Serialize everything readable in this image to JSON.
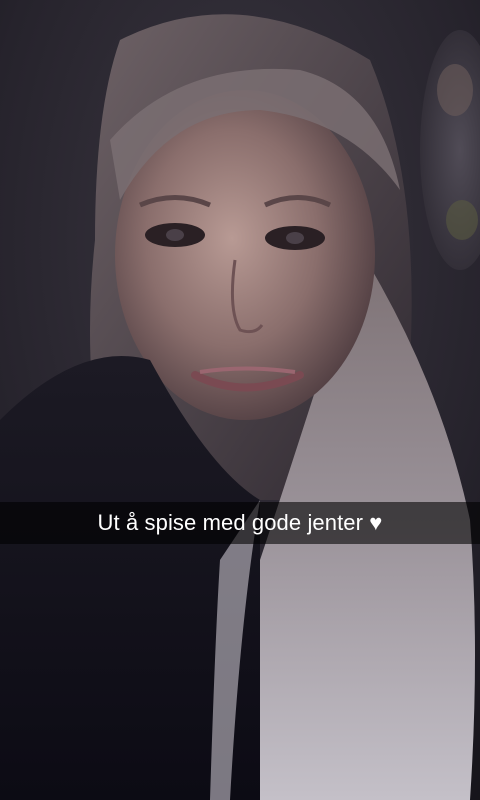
{
  "snap": {
    "caption": "Ut å spise med gode jenter ♥"
  }
}
